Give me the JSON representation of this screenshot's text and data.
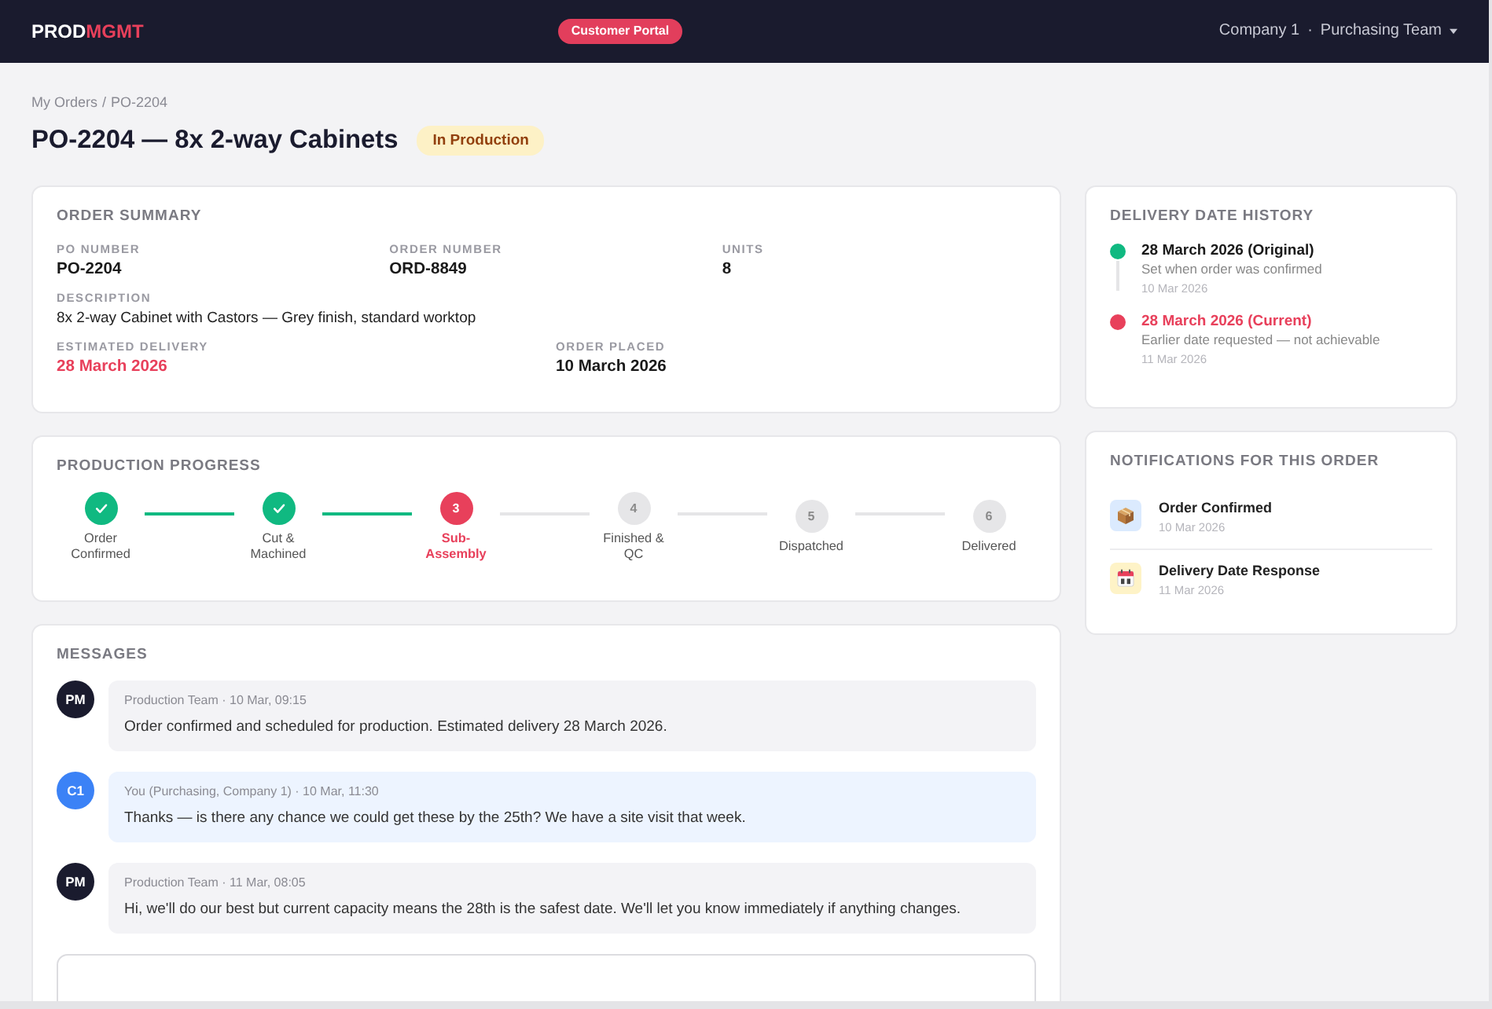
{
  "header": {
    "logo": {
      "primary": "PROD",
      "accent": "MGMT"
    },
    "portal_badge": "Customer Portal",
    "account_menu": {
      "company": "Company 1",
      "separator": "·",
      "team": "Purchasing Team"
    }
  },
  "breadcrumb": {
    "items": [
      "My Orders",
      "PO-2204"
    ],
    "separator": "/"
  },
  "page_title": "PO-2204 — 8x 2-way Cabinets",
  "status_badge": "In Production",
  "order_summary": {
    "title": "ORDER SUMMARY",
    "rows": [
      [
        {
          "label": "PO NUMBER",
          "value": "PO-2204",
          "kind": "strong"
        },
        {
          "label": "ORDER NUMBER",
          "value": "ORD-8849",
          "kind": "strong"
        },
        {
          "label": "UNITS",
          "value": "8",
          "kind": "strong"
        }
      ],
      [
        {
          "label": "DESCRIPTION",
          "value": "8x 2-way Cabinet with Castors — Grey finish, standard worktop",
          "kind": "plain"
        }
      ],
      [
        {
          "label": "ESTIMATED DELIVERY",
          "value": "28 March 2026",
          "kind": "alert"
        },
        {
          "label": "ORDER PLACED",
          "value": "10 March 2026",
          "kind": "strong"
        }
      ]
    ]
  },
  "progress": {
    "title": "PRODUCTION PROGRESS",
    "steps": [
      {
        "label": "Order Confirmed",
        "completed": true,
        "current": false
      },
      {
        "label": "Cut & Machined",
        "completed": true,
        "current": false
      },
      {
        "label": "Sub-Assembly",
        "number": "3",
        "completed": false,
        "current": true
      },
      {
        "label": "Finished & QC",
        "number": "4",
        "completed": false,
        "current": false
      },
      {
        "label": "Dispatched",
        "number": "5",
        "completed": false,
        "current": false
      },
      {
        "label": "Delivered",
        "number": "6",
        "completed": false,
        "current": false
      }
    ]
  },
  "messages": {
    "title": "MESSAGES",
    "items": [
      {
        "initials": "PM",
        "meta": "Production Team · 10 Mar, 09:15",
        "text": "Order confirmed and scheduled for production. Estimated delivery 28 March 2026.",
        "kind": "received"
      },
      {
        "initials": "C1",
        "meta": "You (Purchasing, Company 1) · 10 Mar, 11:30",
        "text": "Thanks — is there any chance we could get these by the 25th? We have a site visit that week.",
        "kind": "sent"
      },
      {
        "initials": "PM",
        "meta": "Production Team · 11 Mar, 08:05",
        "text": "Hi, we'll do our best but current capacity means the 28th is the safest date. We'll let you know immediately if anything changes.",
        "kind": "received"
      }
    ]
  },
  "delivery_history": {
    "title": "DELIVERY DATE HISTORY",
    "entries": [
      {
        "date": "28 March 2026 (Original)",
        "note": "Set when order was confirmed",
        "recorded": "10 Mar 2026",
        "color": "#10b981",
        "current": false
      },
      {
        "date": "28 March 2026 (Current)",
        "note": "Earlier date requested — not achievable",
        "recorded": "11 Mar 2026",
        "color": "#e8405b",
        "current": true
      }
    ]
  },
  "notifications": {
    "title": "NOTIFICATIONS FOR THIS ORDER",
    "items": [
      {
        "title": "Order Confirmed",
        "date": "10 Mar 2026",
        "kind": "order"
      },
      {
        "title": "Delivery Date Response",
        "date": "11 Mar 2026",
        "kind": "date"
      }
    ]
  }
}
